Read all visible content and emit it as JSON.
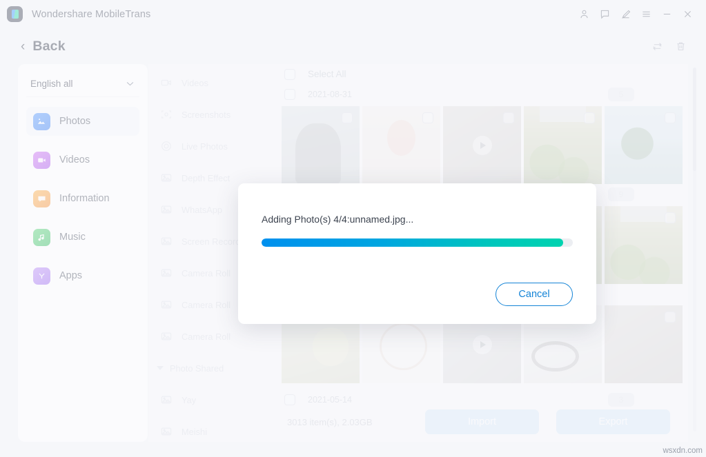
{
  "window": {
    "title": "Wondershare MobileTrans",
    "controls": [
      {
        "name": "account-icon",
        "label": "Account"
      },
      {
        "name": "feedback-icon",
        "label": "Feedback"
      },
      {
        "name": "edit-icon",
        "label": "Edit"
      },
      {
        "name": "menu-icon",
        "label": "Menu"
      },
      {
        "name": "minimize-icon",
        "label": "Minimize"
      },
      {
        "name": "close-icon",
        "label": "Close"
      }
    ]
  },
  "subheader": {
    "back_label": "Back",
    "back_chevron": "‹",
    "refresh_label": "Refresh",
    "delete_label": "Delete"
  },
  "sidebar": {
    "language": {
      "value": "English all",
      "chevron": "⌄"
    },
    "items": [
      {
        "label": "Photos",
        "icon": "photos-icon",
        "active": true
      },
      {
        "label": "Videos",
        "icon": "videos-icon",
        "active": false
      },
      {
        "label": "Information",
        "icon": "information-icon",
        "active": false
      },
      {
        "label": "Music",
        "icon": "music-icon",
        "active": false
      },
      {
        "label": "Apps",
        "icon": "apps-icon",
        "active": false
      }
    ]
  },
  "albums": [
    {
      "label": "Videos",
      "icon": "video-camera-icon",
      "type": "item"
    },
    {
      "label": "Screenshots",
      "icon": "screenshot-icon",
      "type": "item"
    },
    {
      "label": "Live Photos",
      "icon": "live-photo-icon",
      "type": "item"
    },
    {
      "label": "Depth Effect",
      "icon": "photo-icon",
      "type": "item"
    },
    {
      "label": "WhatsApp",
      "icon": "photo-icon",
      "type": "item"
    },
    {
      "label": "Screen Recorder",
      "icon": "photo-icon",
      "type": "item"
    },
    {
      "label": "Camera Roll",
      "icon": "photo-icon",
      "type": "item"
    },
    {
      "label": "Camera Roll",
      "icon": "photo-icon",
      "type": "item"
    },
    {
      "label": "Camera Roll",
      "icon": "photo-icon",
      "type": "item"
    },
    {
      "label": "Photo Shared",
      "icon": "triangle-down-icon",
      "type": "group"
    },
    {
      "label": "Yay",
      "icon": "photo-icon",
      "type": "item"
    },
    {
      "label": "Meishi",
      "icon": "photo-icon",
      "type": "item"
    }
  ],
  "content": {
    "select_all_label": "Select All",
    "groups": [
      {
        "date": "2021-08-31",
        "badge": "5",
        "thumbs": [
          {
            "name": "thumb-person",
            "kind": "photo",
            "fill": "t-person"
          },
          {
            "name": "thumb-flowers",
            "kind": "photo",
            "fill": "t-flowers"
          },
          {
            "name": "thumb-video-dark",
            "kind": "video",
            "fill": "t-dark"
          },
          {
            "name": "thumb-green-field",
            "kind": "photo",
            "fill": "t-green"
          },
          {
            "name": "thumb-palms",
            "kind": "photo",
            "fill": "t-palms"
          }
        ]
      },
      {
        "date": "",
        "badge": "9",
        "thumbs": [
          {
            "name": "thumb-blank-1",
            "kind": "photo",
            "fill": "t-dark"
          },
          {
            "name": "thumb-blank-2",
            "kind": "photo",
            "fill": "t-dark"
          },
          {
            "name": "thumb-blank-3",
            "kind": "photo",
            "fill": "t-dark"
          },
          {
            "name": "thumb-green-field-2",
            "kind": "photo",
            "fill": "t-green"
          },
          {
            "name": "thumb-green-field-3",
            "kind": "photo",
            "fill": "t-green"
          }
        ]
      },
      {
        "date": "",
        "badge": "",
        "thumbs": [
          {
            "name": "thumb-mushroom",
            "kind": "photo",
            "fill": "t-mushroom"
          },
          {
            "name": "thumb-chart",
            "kind": "photo",
            "fill": "t-chart"
          },
          {
            "name": "thumb-video-room",
            "kind": "video",
            "fill": "t-room"
          },
          {
            "name": "thumb-cable",
            "kind": "photo",
            "fill": "t-cable"
          },
          {
            "name": "thumb-blank-4",
            "kind": "photo",
            "fill": "t-dark"
          }
        ]
      }
    ],
    "last_group": {
      "date": "2021-05-14",
      "badge": "3"
    }
  },
  "bottombar": {
    "count_text": "3013 item(s), 2.03GB",
    "import_label": "Import",
    "export_label": "Export"
  },
  "modal": {
    "message": "Adding Photo(s) 4/4:unnamed.jpg...",
    "progress_percent": 97,
    "cancel_label": "Cancel"
  },
  "watermark": "wsxdn.com",
  "colors": {
    "window_bg": "#f2f4f8",
    "panel_bg": "#ffffff",
    "accent_blue": "#1383d6",
    "progress_start": "#0090ee",
    "progress_end": "#00d3b0",
    "action_button": "#bcd9f5"
  }
}
